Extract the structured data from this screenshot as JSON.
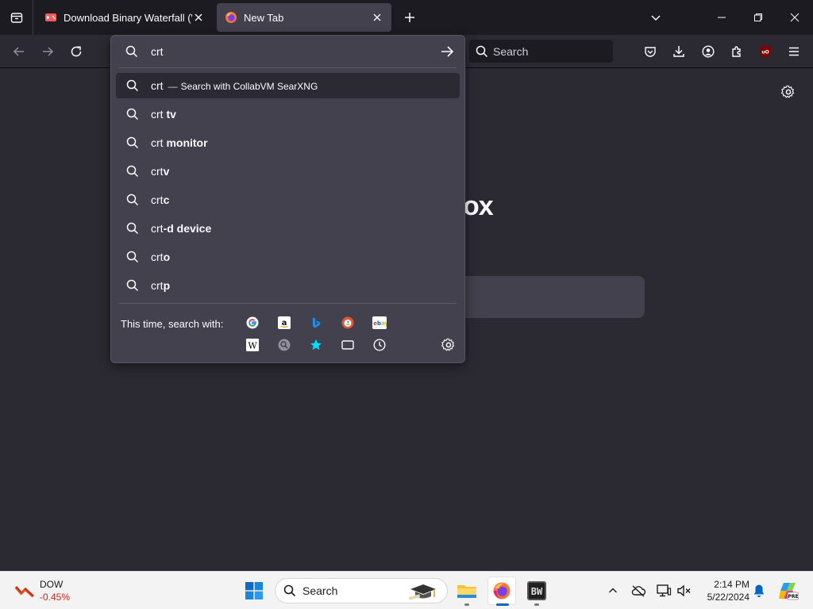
{
  "tabs": [
    {
      "title": "Download Binary Waterfall (Win",
      "active": false
    },
    {
      "title": "New Tab",
      "active": true
    }
  ],
  "toolbar": {
    "search_placeholder": "Search"
  },
  "content": {
    "brand_fragment": "ox"
  },
  "urlbar": {
    "input_value": "crt",
    "suggestions": [
      {
        "prefix": "crt",
        "bold": "",
        "action": "Search with CollabVM SearXNG",
        "selected": true
      },
      {
        "prefix": "crt ",
        "bold": "tv"
      },
      {
        "prefix": "crt ",
        "bold": "monitor"
      },
      {
        "prefix": "crt",
        "bold": "v"
      },
      {
        "prefix": "crt",
        "bold": "c"
      },
      {
        "prefix": "crt",
        "bold": "-d device"
      },
      {
        "prefix": "crt",
        "bold": "o"
      },
      {
        "prefix": "crt",
        "bold": "p"
      }
    ],
    "oneoff_label": "This time, search with:",
    "oneoff_engines": [
      "google-icon",
      "amazon-icon",
      "bing-icon",
      "duckduckgo-icon",
      "ebay-icon",
      "wikipedia-icon",
      "searxng-icon",
      "bookmarks-icon",
      "tabs-icon",
      "history-icon"
    ]
  },
  "taskbar": {
    "stock_name": "DOW",
    "stock_change": "-0.45%",
    "search_label": "Search",
    "time": "2:14 PM",
    "date": "5/22/2024"
  },
  "colors": {
    "accent": "#00ddff",
    "ublock": "#800000",
    "stock_negative": "#c42b1c"
  }
}
